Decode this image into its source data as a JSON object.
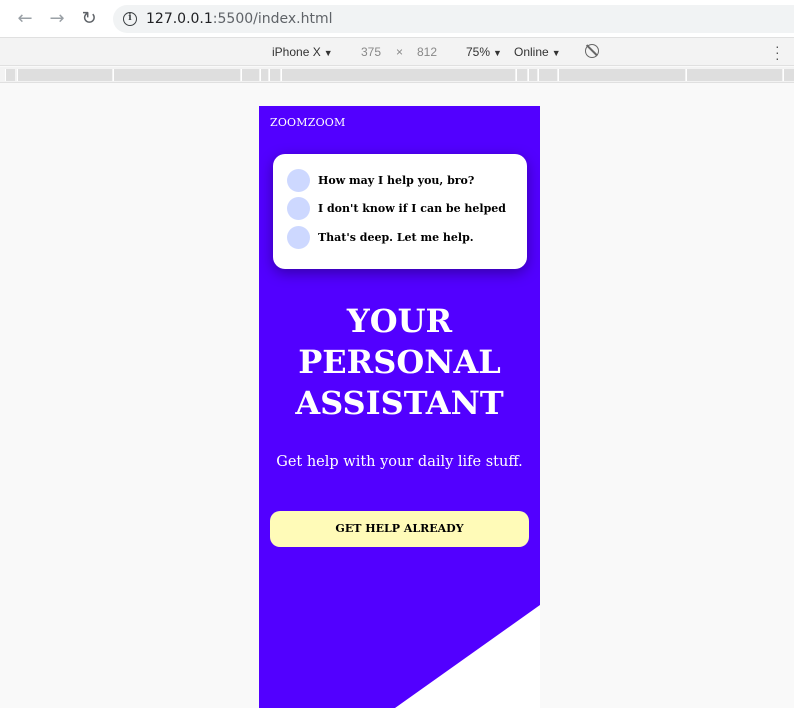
{
  "browser": {
    "url_host": "127.0.0.1",
    "url_rest": ":5500/index.html"
  },
  "device_toolbar": {
    "device": "iPhone X",
    "width": "375",
    "times": "×",
    "height": "812",
    "zoom": "75%",
    "network": "Online"
  },
  "app": {
    "brand": "ZOOMZOOM",
    "chat": [
      {
        "text": "How may I help you, bro?"
      },
      {
        "text": "I don't know if I can be helped"
      },
      {
        "text": "That's deep. Let me help."
      }
    ],
    "headline": [
      "YOUR",
      "PERSONAL",
      "ASSISTANT"
    ],
    "subtitle": "Get help with your daily life stuff.",
    "cta_label": "GET HELP ALREADY"
  },
  "colors": {
    "background": "#5200ff",
    "card": "#ffffff",
    "bubble": "#cdd8ff",
    "cta": "#fffbb8"
  },
  "icons": [
    "back-arrow-icon",
    "forward-arrow-icon",
    "reload-icon",
    "info-icon",
    "rotate-icon",
    "more-icon"
  ]
}
